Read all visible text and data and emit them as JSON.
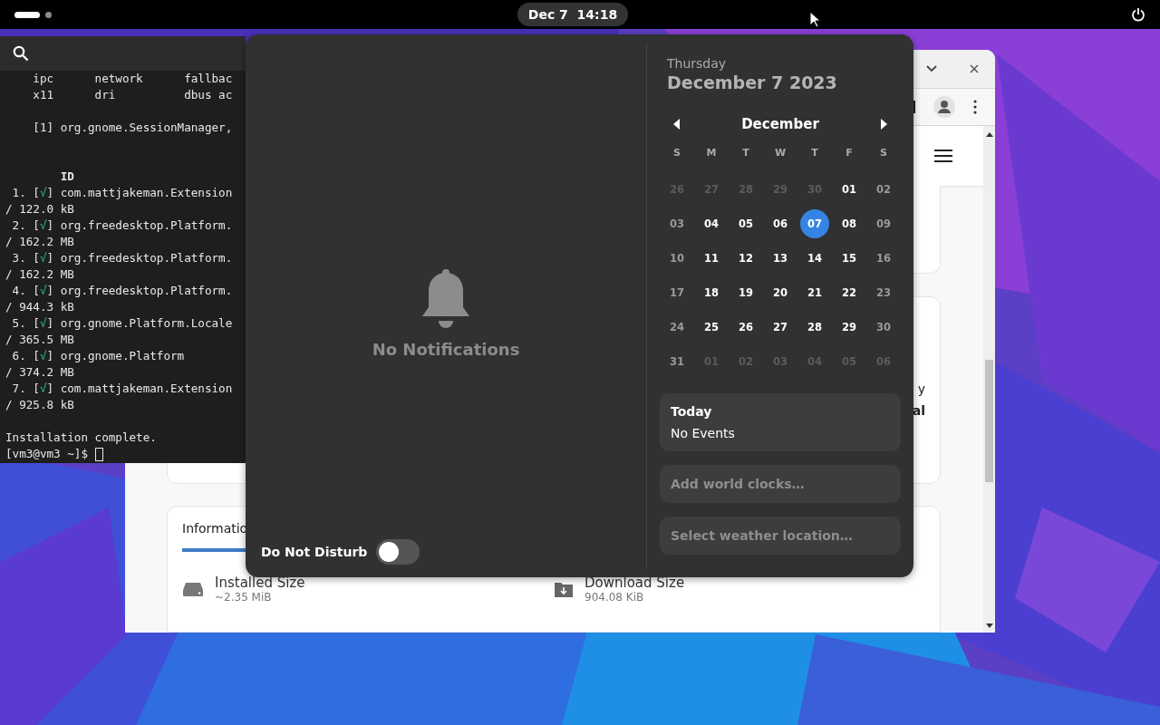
{
  "top_bar": {
    "workspaces": [
      {
        "selected": true
      },
      {
        "selected": false
      }
    ],
    "clock": "Dec 7  14:18"
  },
  "terminal": {
    "lines": [
      {
        "kind": "text",
        "text": "    ipc      network      fallbac"
      },
      {
        "kind": "text",
        "text": "    x11      dri          dbus ac"
      },
      {
        "kind": "blank"
      },
      {
        "kind": "text",
        "text": "    [1] org.gnome.SessionManager,"
      },
      {
        "kind": "blank"
      },
      {
        "kind": "blank"
      },
      {
        "kind": "heading",
        "text": "        ID"
      },
      {
        "kind": "entry",
        "before": " 1. [",
        "mark": "√",
        "after": "] com.mattjakeman.Extension"
      },
      {
        "kind": "text",
        "text": "/ 122.0 kB"
      },
      {
        "kind": "entry",
        "before": " 2. [",
        "mark": "√",
        "after": "] org.freedesktop.Platform."
      },
      {
        "kind": "text",
        "text": "/ 162.2 MB"
      },
      {
        "kind": "entry",
        "before": " 3. [",
        "mark": "√",
        "after": "] org.freedesktop.Platform."
      },
      {
        "kind": "text",
        "text": "/ 162.2 MB"
      },
      {
        "kind": "entry",
        "before": " 4. [",
        "mark": "√",
        "after": "] org.freedesktop.Platform."
      },
      {
        "kind": "text",
        "text": "/ 944.3 kB"
      },
      {
        "kind": "entry",
        "before": " 5. [",
        "mark": "√",
        "after": "] org.gnome.Platform.Locale"
      },
      {
        "kind": "text",
        "text": "/ 365.5 MB"
      },
      {
        "kind": "entry",
        "before": " 6. [",
        "mark": "√",
        "after": "] org.gnome.Platform"
      },
      {
        "kind": "text",
        "text": "/ 374.2 MB"
      },
      {
        "kind": "entry",
        "before": " 7. [",
        "mark": "√",
        "after": "] com.mattjakeman.Extension"
      },
      {
        "kind": "text",
        "text": "/ 925.8 kB"
      },
      {
        "kind": "blank"
      },
      {
        "kind": "text",
        "text": "Installation complete."
      }
    ],
    "prompt": "[vm3@vm3 ~]$ "
  },
  "browser": {
    "fragments": [
      "y",
      "al"
    ],
    "tab": "Informatio",
    "details": [
      {
        "kind": "drive",
        "label": "Installed Size",
        "value": "~2.35 MiB"
      },
      {
        "kind": "download",
        "label": "Download Size",
        "value": "904.08 KiB"
      }
    ]
  },
  "notifications": {
    "empty_text": "No Notifications",
    "do_not_disturb": {
      "label": "Do Not Disturb",
      "on": false
    }
  },
  "calendar": {
    "weekday": "Thursday",
    "date": "December 7 2023",
    "month": "December",
    "day_headers": [
      "S",
      "M",
      "T",
      "W",
      "T",
      "F",
      "S"
    ],
    "days": [
      {
        "day": "26",
        "kind": "other",
        "selected": false
      },
      {
        "day": "27",
        "kind": "other",
        "selected": false
      },
      {
        "day": "28",
        "kind": "other",
        "selected": false
      },
      {
        "day": "29",
        "kind": "other",
        "selected": false
      },
      {
        "day": "30",
        "kind": "other",
        "selected": false
      },
      {
        "day": "01",
        "kind": "weekday",
        "selected": false
      },
      {
        "day": "02",
        "kind": "weekend",
        "selected": false
      },
      {
        "day": "03",
        "kind": "weekend",
        "selected": false
      },
      {
        "day": "04",
        "kind": "weekday",
        "selected": false
      },
      {
        "day": "05",
        "kind": "weekday",
        "selected": false
      },
      {
        "day": "06",
        "kind": "weekday",
        "selected": false
      },
      {
        "day": "07",
        "kind": "weekday",
        "selected": true
      },
      {
        "day": "08",
        "kind": "weekday",
        "selected": false
      },
      {
        "day": "09",
        "kind": "weekend",
        "selected": false
      },
      {
        "day": "10",
        "kind": "weekend",
        "selected": false
      },
      {
        "day": "11",
        "kind": "weekday",
        "selected": false
      },
      {
        "day": "12",
        "kind": "weekday",
        "selected": false
      },
      {
        "day": "13",
        "kind": "weekday",
        "selected": false
      },
      {
        "day": "14",
        "kind": "weekday",
        "selected": false
      },
      {
        "day": "15",
        "kind": "weekday",
        "selected": false
      },
      {
        "day": "16",
        "kind": "weekend",
        "selected": false
      },
      {
        "day": "17",
        "kind": "weekend",
        "selected": false
      },
      {
        "day": "18",
        "kind": "weekday",
        "selected": false
      },
      {
        "day": "19",
        "kind": "weekday",
        "selected": false
      },
      {
        "day": "20",
        "kind": "weekday",
        "selected": false
      },
      {
        "day": "21",
        "kind": "weekday",
        "selected": false
      },
      {
        "day": "22",
        "kind": "weekday",
        "selected": false
      },
      {
        "day": "23",
        "kind": "weekend",
        "selected": false
      },
      {
        "day": "24",
        "kind": "weekend",
        "selected": false
      },
      {
        "day": "25",
        "kind": "weekday",
        "selected": false
      },
      {
        "day": "26",
        "kind": "weekday",
        "selected": false
      },
      {
        "day": "27",
        "kind": "weekday",
        "selected": false
      },
      {
        "day": "28",
        "kind": "weekday",
        "selected": false
      },
      {
        "day": "29",
        "kind": "weekday",
        "selected": false
      },
      {
        "day": "30",
        "kind": "weekend",
        "selected": false
      },
      {
        "day": "31",
        "kind": "weekend",
        "selected": false
      },
      {
        "day": "01",
        "kind": "other",
        "selected": false
      },
      {
        "day": "02",
        "kind": "other",
        "selected": false
      },
      {
        "day": "03",
        "kind": "other",
        "selected": false
      },
      {
        "day": "04",
        "kind": "other",
        "selected": false
      },
      {
        "day": "05",
        "kind": "other",
        "selected": false
      },
      {
        "day": "06",
        "kind": "other",
        "selected": false
      }
    ],
    "events": {
      "title": "Today",
      "text": "No Events"
    },
    "world_clocks": "Add world clocks…",
    "weather": "Select weather location…"
  }
}
